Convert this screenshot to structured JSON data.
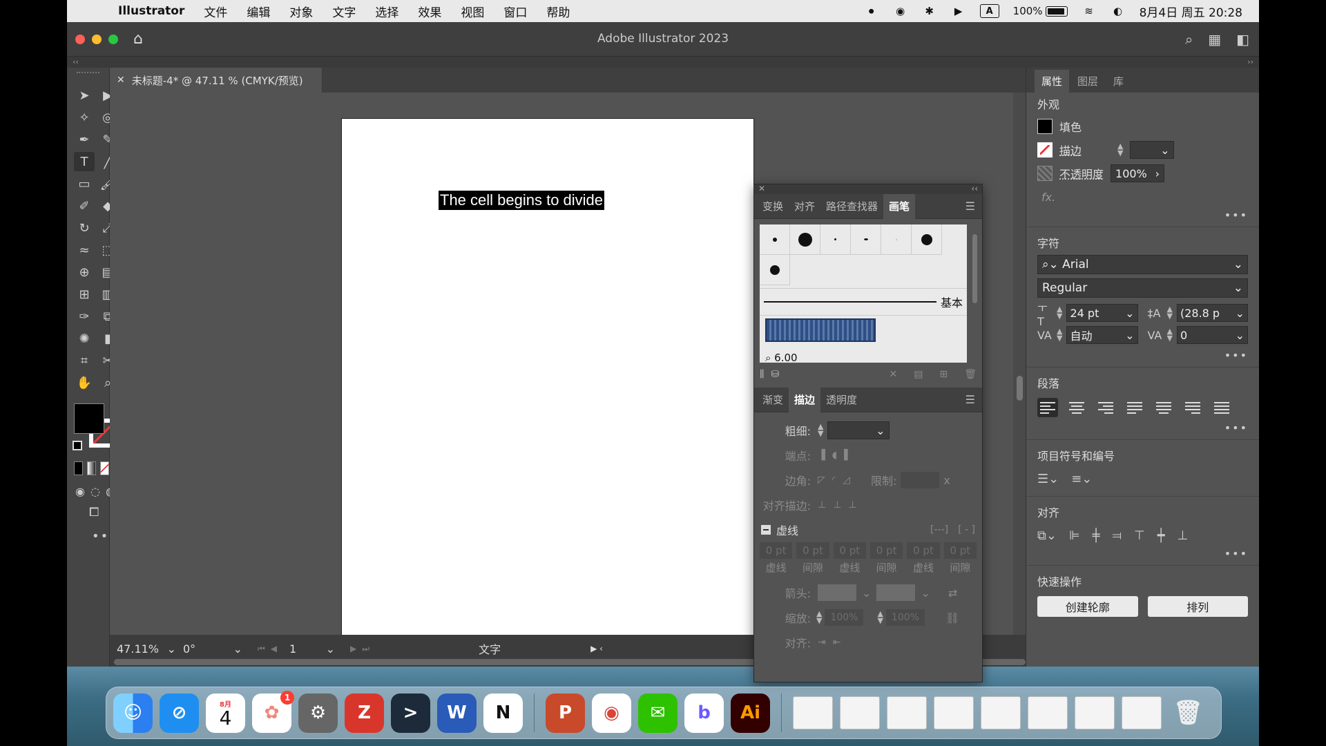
{
  "menubar": {
    "app_name": "Illustrator",
    "items": [
      "文件",
      "编辑",
      "对象",
      "文字",
      "选择",
      "效果",
      "视图",
      "窗口",
      "帮助"
    ],
    "input_method": "A",
    "battery": "100%",
    "datetime": "8月4日 周五 20:28"
  },
  "window": {
    "title": "Adobe Illustrator 2023"
  },
  "document_tab": {
    "label": "未标题-4* @ 47.11 % (CMYK/预览)"
  },
  "canvas": {
    "selected_text": "The cell begins to divide"
  },
  "statusbar": {
    "zoom": "47.11%",
    "rotation": "0°",
    "page": "1",
    "tool": "文字"
  },
  "right_panel": {
    "tabs": [
      "属性",
      "图层",
      "库"
    ],
    "appearance": {
      "title": "外观",
      "fill_label": "填色",
      "stroke_label": "描边",
      "opacity_label": "不透明度",
      "opacity_value": "100%",
      "fx_label": "fx."
    },
    "character": {
      "title": "字符",
      "font_family": "Arial",
      "font_style": "Regular",
      "font_size": "24 pt",
      "leading": "(28.8 p",
      "kerning": "自动",
      "tracking": "0"
    },
    "paragraph": {
      "title": "段落"
    },
    "bullets": {
      "title": "项目符号和编号"
    },
    "align": {
      "title": "对齐"
    },
    "quick_actions": {
      "title": "快速操作",
      "outline_button": "创建轮廓",
      "arrange_button": "排列"
    }
  },
  "float_panel": {
    "tabs": [
      "变换",
      "对齐",
      "路径查找器",
      "画笔"
    ],
    "active_tab": "画笔",
    "brush_basic_label": "基本",
    "brush_size_label": "6.00",
    "stroke_tabs": [
      "渐变",
      "描边",
      "透明度"
    ],
    "stroke": {
      "weight_label": "粗细:",
      "cap_label": "端点:",
      "corner_label": "边角:",
      "limit_label": "限制:",
      "limit_unit": "x",
      "align_label": "对齐描边:",
      "dashed_label": "虚线",
      "dash_values": [
        "0 pt",
        "0 pt",
        "0 pt",
        "0 pt",
        "0 pt",
        "0 pt"
      ],
      "dash_labels": [
        "虚线",
        "间隙",
        "虚线",
        "间隙",
        "虚线",
        "间隙"
      ],
      "arrow_label": "箭头:",
      "scale_label": "缩放:",
      "scale_values": [
        "100%",
        "100%"
      ],
      "align_arrow_label": "对齐:"
    }
  },
  "dock": {
    "calendar_month": "8月",
    "calendar_day": "4",
    "photos_badge": "1",
    "illustrator_label": "Ai"
  }
}
